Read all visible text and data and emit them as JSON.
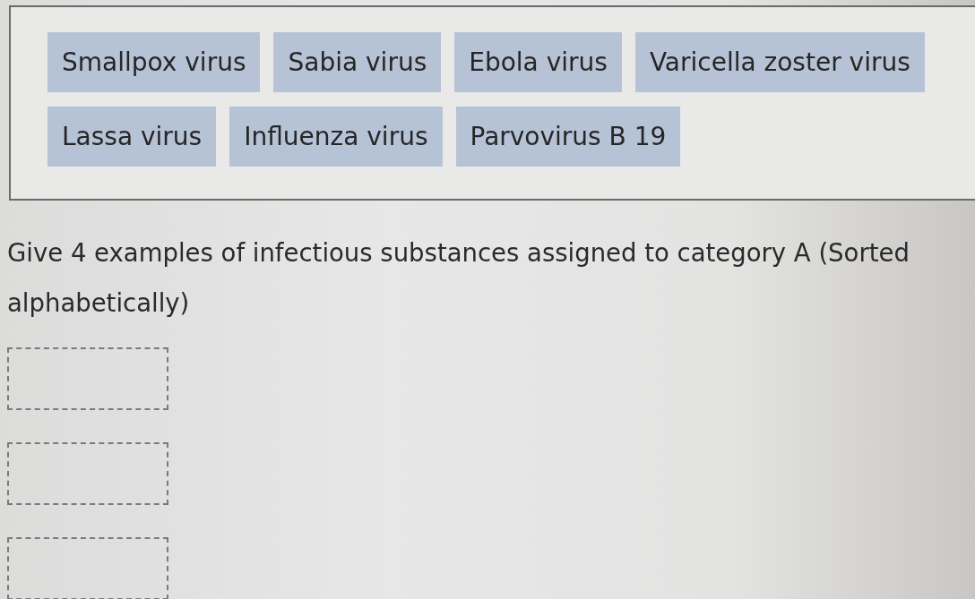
{
  "answer_bank": {
    "items": [
      "Smallpox virus",
      "Sabia virus",
      "Ebola virus",
      "Varicella zoster virus",
      "Lassa virus",
      "Influenza virus",
      "Parvovirus B 19"
    ]
  },
  "question": "Give 4 examples of infectious substances assigned to category A (Sorted alphabetically)",
  "drop_zones": [
    {
      "kind": "empty"
    },
    {
      "kind": "empty"
    },
    {
      "kind": "empty"
    }
  ]
}
